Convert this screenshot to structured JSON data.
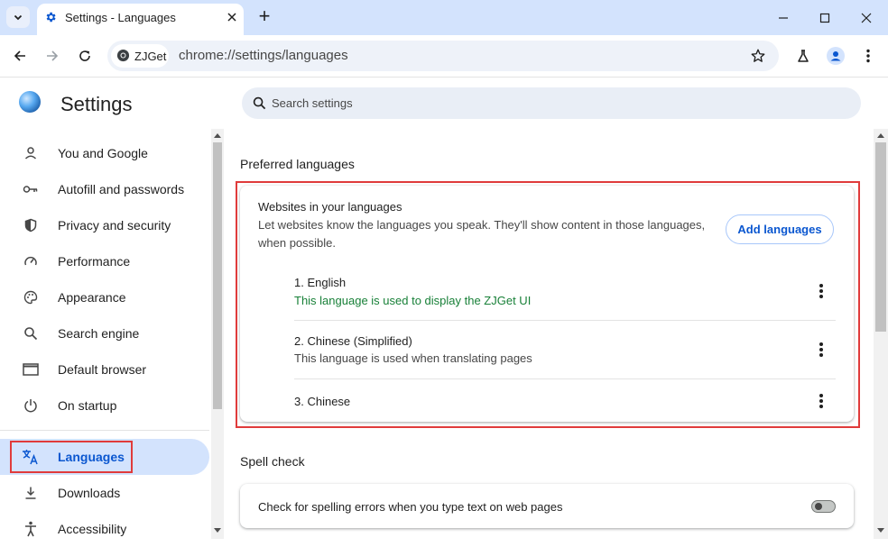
{
  "browser": {
    "tab_title": "Settings - Languages",
    "new_tab_symbol": "+",
    "site_chip": "ZJGet",
    "url": "chrome://settings/languages"
  },
  "settings": {
    "title": "Settings",
    "search_placeholder": "Search settings",
    "nav": [
      {
        "label": "You and Google",
        "icon": "person-icon"
      },
      {
        "label": "Autofill and passwords",
        "icon": "key-icon"
      },
      {
        "label": "Privacy and security",
        "icon": "shield-icon"
      },
      {
        "label": "Performance",
        "icon": "speedometer-icon"
      },
      {
        "label": "Appearance",
        "icon": "palette-icon"
      },
      {
        "label": "Search engine",
        "icon": "search-icon"
      },
      {
        "label": "Default browser",
        "icon": "browser-window-icon"
      },
      {
        "label": "On startup",
        "icon": "power-icon"
      },
      {
        "label": "Languages",
        "icon": "translate-icon",
        "active": true
      },
      {
        "label": "Downloads",
        "icon": "download-icon"
      },
      {
        "label": "Accessibility",
        "icon": "accessibility-icon"
      }
    ]
  },
  "content": {
    "preferred_title": "Preferred languages",
    "websites_title": "Websites in your languages",
    "websites_desc_line1": "Let websites know the languages you speak. They'll show content in those languages,",
    "websites_desc_line2": "when possible.",
    "add_languages": "Add languages",
    "languages": [
      {
        "name": "1. English",
        "note": "This language is used to display the ZJGet UI",
        "note_color": "#188038"
      },
      {
        "name": "2. Chinese (Simplified)",
        "note": "This language is used when translating pages",
        "note_color": "#474747"
      },
      {
        "name": "3. Chinese",
        "note": ""
      }
    ],
    "spell_title": "Spell check",
    "spell_toggle_label": "Check for spelling errors when you type text on web pages",
    "spell_toggle_on": false
  },
  "colors": {
    "tabstrip": "#d3e3fd",
    "accent": "#0b57d0",
    "highlight": "#e03b3b"
  }
}
